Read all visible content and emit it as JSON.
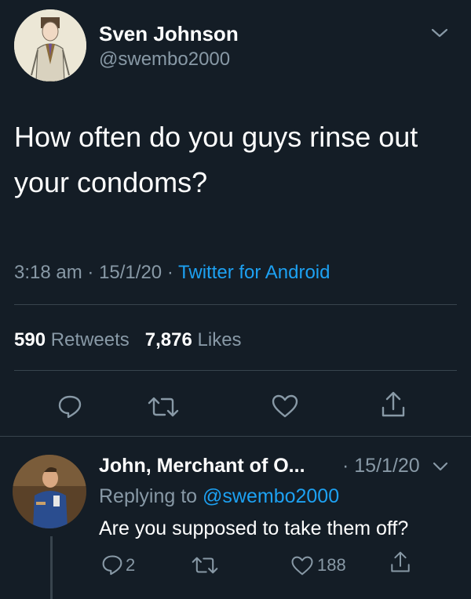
{
  "main_tweet": {
    "author_name": "Sven Johnson",
    "author_handle": "@swembo2000",
    "text_line1": "How often do you guys rinse out",
    "text_line2": "your condoms?",
    "time": "3:18 am",
    "date": "15/1/20",
    "source": "Twitter for Android",
    "retweets_count": "590",
    "retweets_label": "Retweets",
    "likes_count": "7,876",
    "likes_label": "Likes",
    "icons": [
      "reply-icon",
      "retweet-icon",
      "like-icon",
      "share-icon",
      "chevron-down-icon"
    ]
  },
  "reply_tweet": {
    "author_name": "John, Merchant of O...",
    "date": "15/1/20",
    "replying_label": "Replying to",
    "replying_handle": "@swembo2000",
    "text": "Are you supposed to take them off?",
    "reply_count": "2",
    "like_count": "188",
    "icons": [
      "reply-icon",
      "retweet-icon",
      "like-icon",
      "share-icon",
      "chevron-down-icon"
    ]
  },
  "colors": {
    "background": "#141d26",
    "text": "#ffffff",
    "secondary": "#8899a6",
    "accent": "#1da1f2",
    "divider": "#38444d"
  }
}
